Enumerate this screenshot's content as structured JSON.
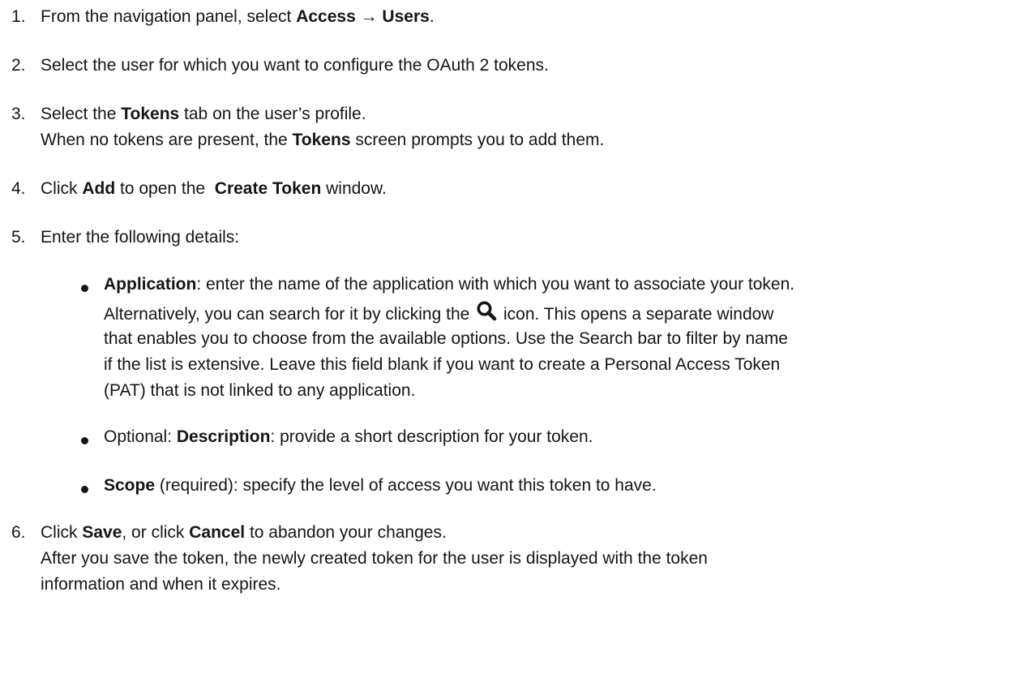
{
  "steps": [
    {
      "number": "1.",
      "lead": "From the navigation panel, select ",
      "ui_path_start": "Access",
      "arrow": " → ",
      "ui_path_end": "Users",
      "end": "."
    },
    {
      "number": "2.",
      "text": "Select the user for which you want to configure the OAuth 2 tokens."
    },
    {
      "number": "3.",
      "lead": "Select the ",
      "ui": "Tokens",
      "trail": " tab on the user’s profile.",
      "note_lead": "When no tokens are present, the ",
      "note_ui": "Tokens",
      "note_trail": " screen prompts you to add them."
    },
    {
      "number": "4.",
      "lead": "Click ",
      "button": "Add",
      "mid": " to open the  ",
      "ui": "Create Token",
      "trail": " window."
    },
    {
      "number": "5.",
      "text": "Enter the following details:",
      "bullets": [
        {
          "label": "Application",
          "desc": ": enter the name of the application with which you want to associate your token.",
          "line2_lead": "Alternatively, you can search for it by clicking the ",
          "line2_trail": " icon. This opens a separate window",
          "line3": "that enables you to choose from the available options. Use the Search bar to filter by name",
          "line4": "if the list is extensive. Leave this field blank if you want to create a Personal Access Token",
          "line5": "(PAT) that is not linked to any application."
        },
        {
          "prefix": "Optional: ",
          "label": "Description",
          "desc": ": provide a short description for your token."
        },
        {
          "label": "Scope",
          "desc": " (required): specify the level of access you want this token to have."
        }
      ]
    },
    {
      "number": "6.",
      "lead": "Click ",
      "button1": "Save",
      "mid": ", or click ",
      "button2": "Cancel",
      "trail": " to abandon your changes.",
      "note_line1": "After you save the token, the newly created token for the user is displayed with the token",
      "note_line2": "information and when it expires."
    }
  ],
  "icons": {
    "search": "search-icon"
  },
  "colors": {
    "text": "#151515",
    "background": "#ffffff"
  }
}
